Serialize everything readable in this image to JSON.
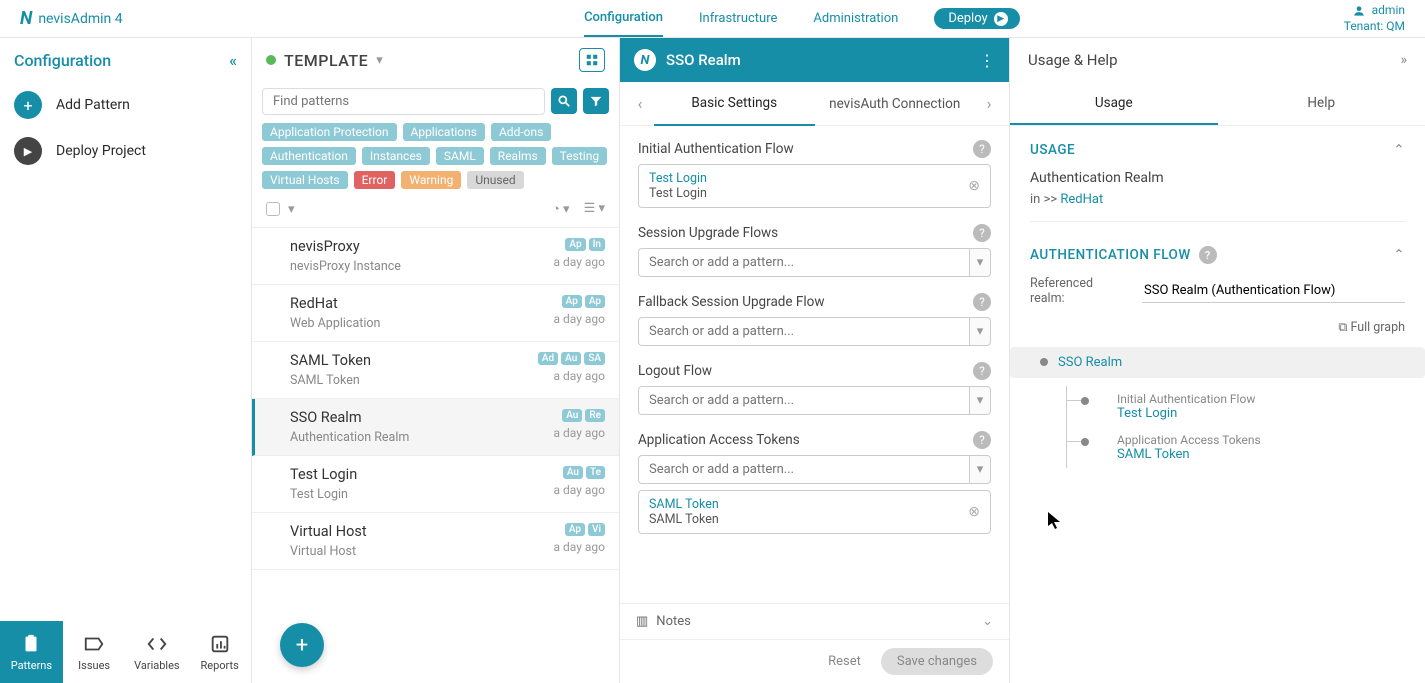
{
  "topbar": {
    "appName": "nevisAdmin 4",
    "nav": {
      "configuration": "Configuration",
      "infrastructure": "Infrastructure",
      "administration": "Administration"
    },
    "deploy": "Deploy",
    "user": {
      "name": "admin",
      "tenant": "Tenant: QM"
    }
  },
  "sidebar": {
    "title": "Configuration",
    "add": "Add Pattern",
    "deploy": "Deploy Project",
    "bottom": {
      "patterns": "Patterns",
      "issues": "Issues",
      "variables": "Variables",
      "reports": "Reports"
    }
  },
  "template": {
    "title": "TEMPLATE",
    "searchPlaceholder": "Find patterns",
    "tags": [
      "Application Protection",
      "Applications",
      "Add-ons",
      "Authentication",
      "Instances",
      "SAML",
      "Realms",
      "Testing",
      "Virtual Hosts"
    ],
    "tagError": "Error",
    "tagWarning": "Warning",
    "tagUnused": "Unused",
    "items": [
      {
        "name": "nevisProxy",
        "sub": "nevisProxy Instance",
        "badges": [
          "Ap",
          "In"
        ],
        "time": "a day ago"
      },
      {
        "name": "RedHat",
        "sub": "Web Application",
        "badges": [
          "Ap",
          "Ap"
        ],
        "time": "a day ago"
      },
      {
        "name": "SAML Token",
        "sub": "SAML Token",
        "badges": [
          "Ad",
          "Au",
          "SA"
        ],
        "time": "a day ago"
      },
      {
        "name": "SSO Realm",
        "sub": "Authentication Realm",
        "badges": [
          "Au",
          "Re"
        ],
        "time": "a day ago"
      },
      {
        "name": "Test Login",
        "sub": "Test Login",
        "badges": [
          "Au",
          "Te"
        ],
        "time": "a day ago"
      },
      {
        "name": "Virtual Host",
        "sub": "Virtual Host",
        "badges": [
          "Ap",
          "Vi"
        ],
        "time": "a day ago"
      }
    ]
  },
  "editor": {
    "title": "SSO Realm",
    "tabs": {
      "basic": "Basic Settings",
      "auth": "nevisAuth Connection"
    },
    "searchPatternPlaceholder": "Search or add a pattern...",
    "fields": {
      "initAuth": {
        "label": "Initial Authentication Flow",
        "link": "Test Login",
        "text": "Test Login"
      },
      "sessionUpgrade": {
        "label": "Session Upgrade Flows"
      },
      "fallback": {
        "label": "Fallback Session Upgrade Flow"
      },
      "logout": {
        "label": "Logout Flow"
      },
      "tokens": {
        "label": "Application Access Tokens",
        "link": "SAML Token",
        "text": "SAML Token"
      }
    },
    "notes": "Notes",
    "reset": "Reset",
    "save": "Save changes"
  },
  "help": {
    "title": "Usage & Help",
    "tabs": {
      "usage": "Usage",
      "help": "Help"
    },
    "usage": {
      "head": "USAGE",
      "realm": "Authentication Realm",
      "inText": "in >> ",
      "inLink": "RedHat"
    },
    "authflow": {
      "head": "AUTHENTICATION FLOW",
      "refLabel": "Referenced realm:",
      "refValue": "SSO Realm (Authentication Flow)",
      "fullGraph": "Full graph",
      "root": "SSO Realm",
      "c1label": "Initial Authentication Flow",
      "c1link": "Test Login",
      "c2label": "Application Access Tokens",
      "c2link": "SAML Token"
    }
  }
}
